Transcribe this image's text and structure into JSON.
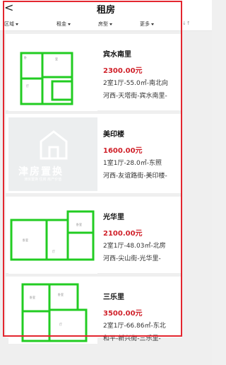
{
  "header": {
    "back_glyph": "<",
    "title": "租房"
  },
  "filters": [
    {
      "label": "区域"
    },
    {
      "label": "租金"
    },
    {
      "label": "房型"
    },
    {
      "label": "更多"
    },
    {
      "label": "↓↑"
    }
  ],
  "listings": [
    {
      "name": "宾水南里",
      "price": "2300.00元",
      "spec": "2室1厅-55.0㎡-南北向",
      "location": "河西-天塔街-宾水南里-"
    },
    {
      "name": "美印楼",
      "price": "1600.00元",
      "spec": "1室1厅-28.0㎡-东照",
      "location": "河西-友谊路街-美印楼-"
    },
    {
      "name": "光华里",
      "price": "2100.00元",
      "spec": "2室1厅-48.03㎡-北房",
      "location": "河西-尖山街-光华里-"
    },
    {
      "name": "三乐里",
      "price": "3500.00元",
      "spec": "2室1厅-66.86㎡-东北",
      "location": "和平-新兴街-三乐里-"
    }
  ],
  "placeholder_logo": {
    "brand": "津房置换",
    "sub": "津房置换 住房 房产价值"
  },
  "colors": {
    "price": "#d0212a",
    "floorplan": "#22cc22",
    "annotation": "#e3262f"
  }
}
